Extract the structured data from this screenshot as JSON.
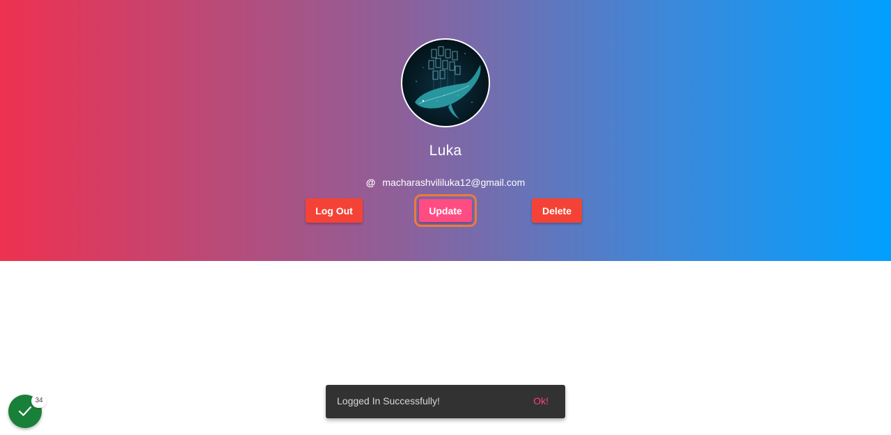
{
  "profile": {
    "name": "Luka",
    "email": "macharashvililuka12@gmail.com",
    "email_icon": "@",
    "avatar_icon": "whale-avatar"
  },
  "actions": {
    "logout_label": "Log Out",
    "update_label": "Update",
    "delete_label": "Delete"
  },
  "snackbar": {
    "message": "Logged In Successfully!",
    "action_label": "Ok!"
  },
  "fab": {
    "icon": "check-icon",
    "badge_count": "34"
  },
  "colors": {
    "danger": "#f44336",
    "accent": "#ff4c83",
    "snackbar_action": "#ff4081",
    "fab": "#188038"
  }
}
